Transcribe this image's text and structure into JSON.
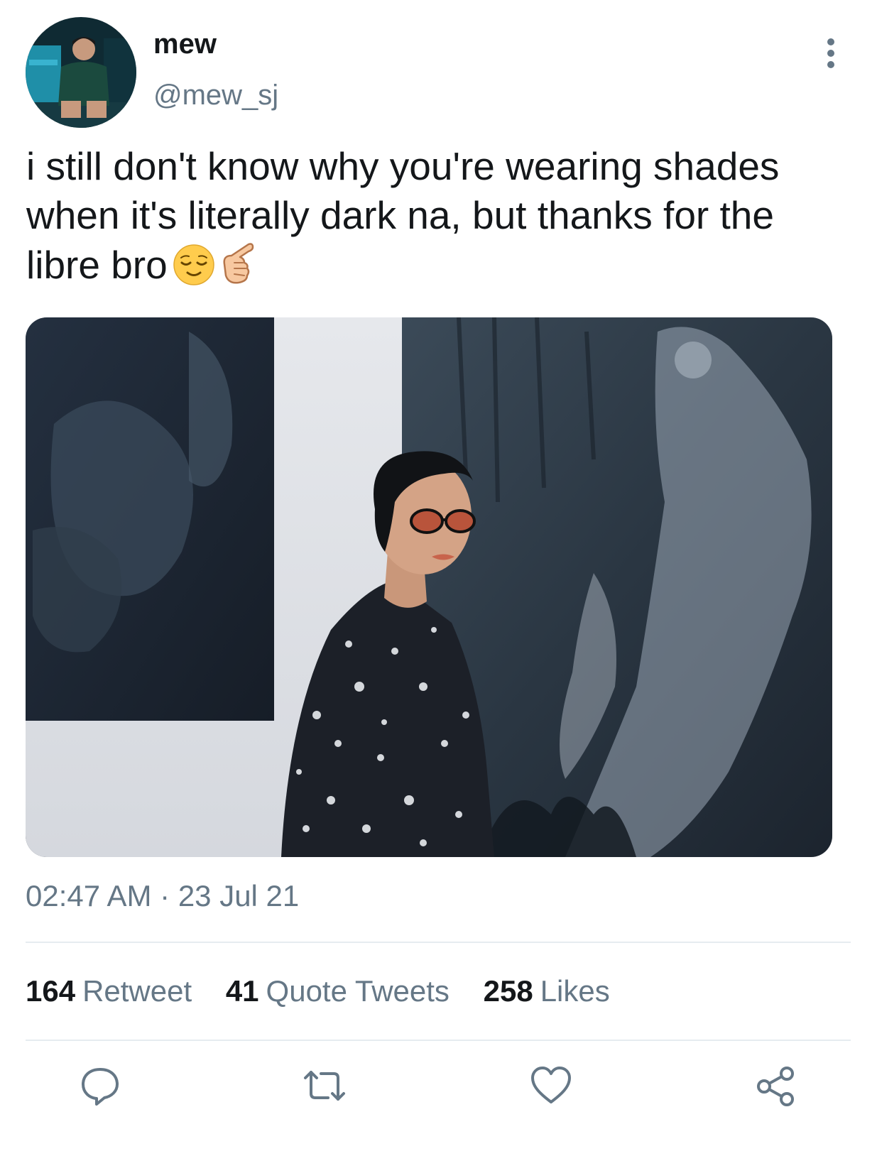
{
  "author": {
    "display_name": "mew",
    "handle": "@mew_sj"
  },
  "tweet": {
    "text_lines": [
      "i still don't know why you're wearing shades",
      "when it's literally dark na, but thanks for the",
      "libre bro"
    ],
    "emojis": [
      "relieved-face",
      "backhand-index-pointing-left"
    ]
  },
  "meta": {
    "time": "02:47 AM",
    "separator": "·",
    "date": "23 Jul 21"
  },
  "stats": {
    "retweets": {
      "count": "164",
      "label": "Retweet"
    },
    "quotes": {
      "count": "41",
      "label": "Quote Tweets"
    },
    "likes": {
      "count": "258",
      "label": "Likes"
    }
  },
  "actions": [
    "reply-icon",
    "retweet-icon",
    "like-icon",
    "share-icon"
  ],
  "colors": {
    "text_primary": "#14171a",
    "text_secondary": "#657786",
    "divider": "#e6ecf0"
  }
}
